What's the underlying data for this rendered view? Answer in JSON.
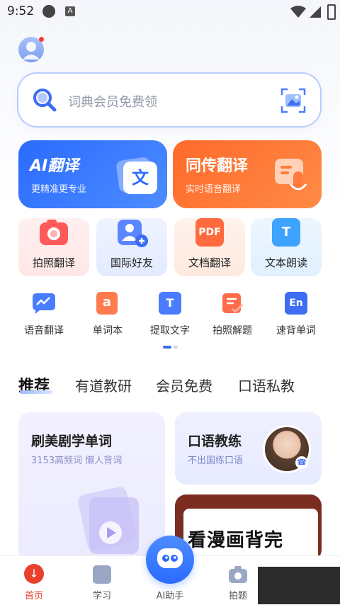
{
  "status_bar": {
    "time": "9:52"
  },
  "search": {
    "placeholder": "词典会员免费领"
  },
  "cards": [
    {
      "title": "AI翻译",
      "subtitle": "更精准更专业",
      "icon_text": "文"
    },
    {
      "title": "同传翻译",
      "subtitle": "实时语音翻译"
    }
  ],
  "tiles": [
    {
      "label": "拍照翻译",
      "icon": "camera-icon"
    },
    {
      "label": "国际好友",
      "icon": "add-friend-icon"
    },
    {
      "label": "文档翻译",
      "icon": "pdf-icon",
      "icon_text": "PDF"
    },
    {
      "label": "文本朗读",
      "icon": "text-speech-icon",
      "icon_text": "T"
    }
  ],
  "tools": [
    {
      "label": "语音翻译",
      "icon": "voice-translate-icon"
    },
    {
      "label": "单词本",
      "icon": "wordbook-icon",
      "icon_text": "a"
    },
    {
      "label": "提取文字",
      "icon": "extract-text-icon",
      "icon_text": "T"
    },
    {
      "label": "拍照解题",
      "icon": "solve-icon"
    },
    {
      "label": "速背单词",
      "icon": "memorize-icon",
      "icon_text": "En"
    }
  ],
  "tabs": [
    "推荐",
    "有道教研",
    "会员免费",
    "口语私教"
  ],
  "feed": {
    "card1": {
      "title": "刷美剧学单词",
      "subtitle": "3153高频词 懒人背词"
    },
    "card2": {
      "title": "口语教练",
      "subtitle": "不出国练口语"
    },
    "card3": {
      "title": "看漫画背完"
    }
  },
  "nav": [
    {
      "label": "首页",
      "active": true
    },
    {
      "label": "学习"
    },
    {
      "label": "AI助手"
    },
    {
      "label": "拍题"
    }
  ],
  "colors": {
    "blue": "#2b6bff",
    "orange": "#ff6a2a",
    "active_nav": "#e8412c"
  }
}
